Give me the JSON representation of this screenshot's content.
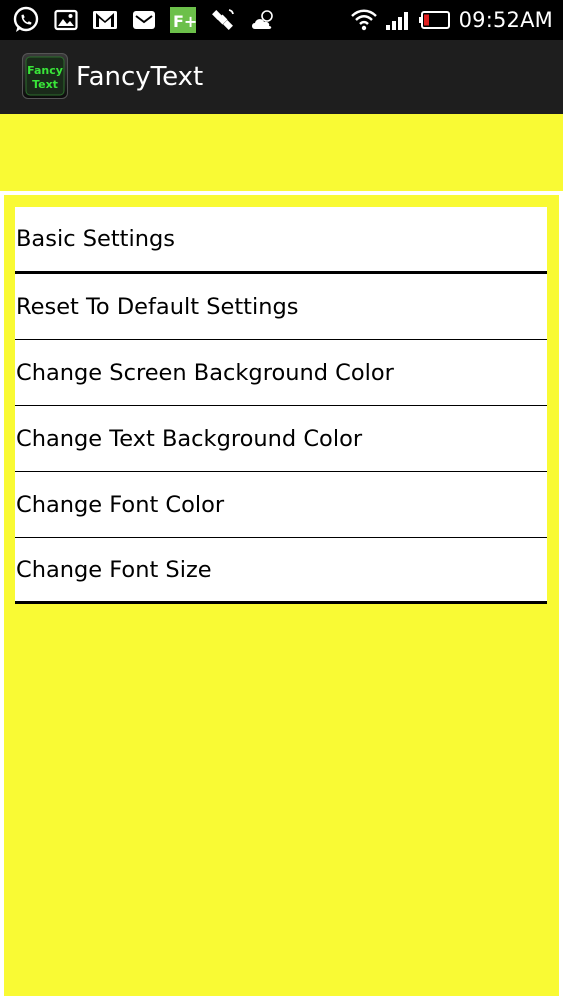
{
  "status_bar": {
    "time": "09:52AM",
    "icons_left": [
      "whatsapp-icon",
      "gallery-icon",
      "gmail-icon",
      "email-icon",
      "feedly-icon",
      "satellite-icon",
      "weather-icon"
    ],
    "icons_right": [
      "wifi-icon",
      "signal-icon",
      "battery-icon"
    ]
  },
  "app_bar": {
    "logo_text_line1": "Fancy",
    "logo_text_line2": "Text",
    "title": "FancyText"
  },
  "menu": {
    "items": [
      {
        "label": "Basic Settings"
      },
      {
        "label": "Reset To Default Settings"
      },
      {
        "label": "Change Screen Background Color"
      },
      {
        "label": "Change Text Background Color"
      },
      {
        "label": "Change Font Color"
      },
      {
        "label": "Change Font Size"
      }
    ]
  },
  "colors": {
    "background": "#f9fa34",
    "app_bar": "#1e1e1e",
    "status_bar": "#000000",
    "list_bg": "#ffffff"
  }
}
